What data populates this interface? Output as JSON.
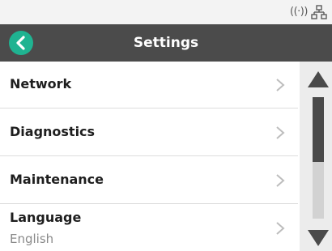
{
  "header": {
    "title": "Settings",
    "back_icon": "back-arrow-icon",
    "accent_color": "#1fb391",
    "bar_color": "#4b4b4b"
  },
  "status": {
    "wifi_icon": "wifi-signal-icon",
    "network_icon": "wired-network-icon"
  },
  "menu": {
    "items": [
      {
        "label": "Network"
      },
      {
        "label": "Diagnostics"
      },
      {
        "label": "Maintenance"
      },
      {
        "label": "Language",
        "value": "English"
      }
    ]
  },
  "scrollbar": {
    "up_icon": "triangle-up-icon",
    "down_icon": "triangle-down-icon",
    "position": 0.0,
    "visible_fraction": 0.53
  }
}
